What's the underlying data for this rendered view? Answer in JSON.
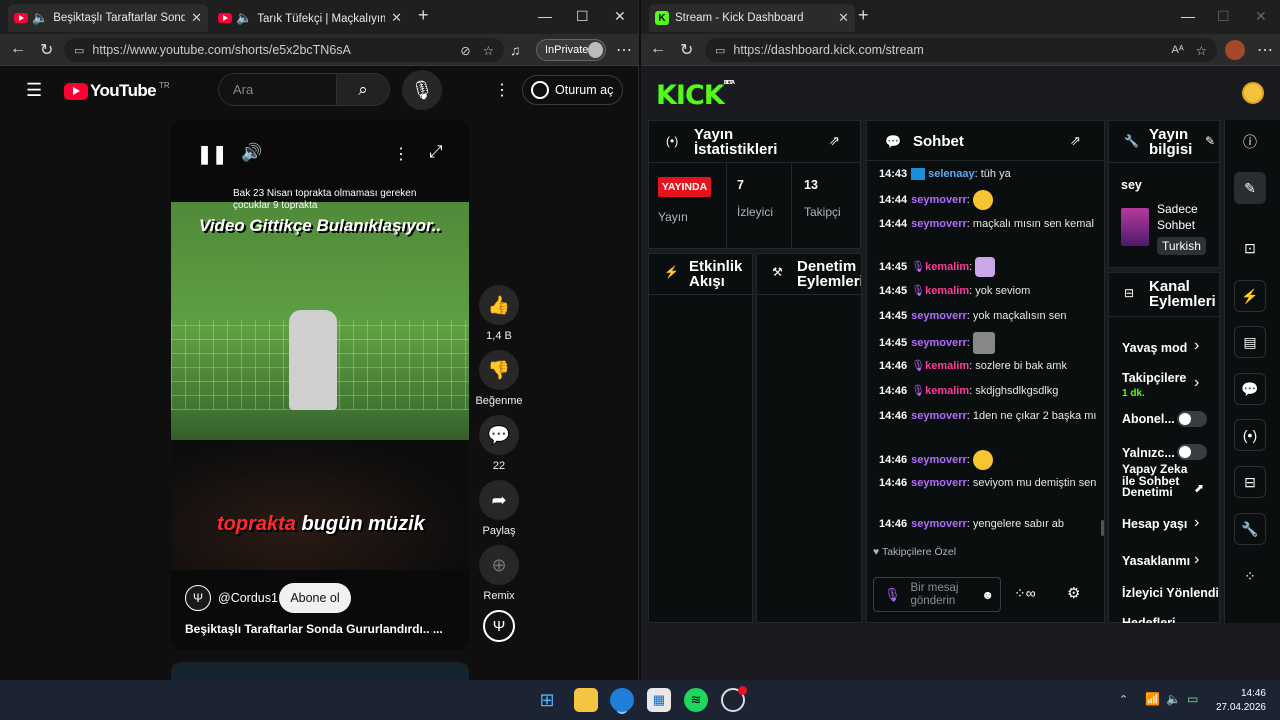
{
  "left_window": {
    "tabs": [
      {
        "title": "Beşiktaşlı Taraftarlar Sonda Gu"
      },
      {
        "title": "Tarık Tüfekçi | Maçkalıyım 🎧"
      }
    ],
    "url": "https://www.youtube.com/shorts/e5x2bcTN6sA",
    "inprivate_label": "InPrivate",
    "youtube": {
      "logo": "YouTube",
      "region": "TR",
      "search_placeholder": "Ara",
      "signin": "Oturum aç"
    },
    "short": {
      "top_caption": "Bak 23 Nisan toprakta olmaması gereken çocuklar 9 toprakta",
      "overlay_title": "Video Gittikçe Bulanıklaşıyor..",
      "overlay_bottom_a": "toprakta",
      "overlay_bottom_b": "bugün müzik",
      "channel": "@Cordus1",
      "subscribe": "Abone ol",
      "title": "Beşiktaşlı Taraftarlar Sonda Gururlandırdı.. ..."
    },
    "actions": {
      "likes": "1,4 B",
      "dislike": "Beğenme",
      "comments": "22",
      "share": "Paylaş",
      "remix": "Remix"
    }
  },
  "right_window": {
    "tab_title": "Stream - Kick Dashboard",
    "url": "https://dashboard.kick.com/stream",
    "logo": "KICK",
    "logo_badge": "BETA",
    "stats": {
      "heading": "Yayın İstatistikleri",
      "live_badge": "YAYINDA",
      "live_label": "Yayın",
      "viewers_value": "7",
      "viewers_label": "İzleyici",
      "followers_value": "13",
      "followers_label": "Takipçi"
    },
    "activity_heading": "Etkinlik Akışı",
    "moderation_heading": "Denetim Eylemleri",
    "chat": {
      "heading": "Sohbet",
      "messages": [
        {
          "time": "14:43",
          "user": "selenaay",
          "text": ": tüh ya"
        },
        {
          "time": "14:44",
          "user": "seymoverr",
          "text": ":"
        },
        {
          "time": "14:44",
          "user": "seymoverr",
          "text": ": maçkalı mısın sen kemal"
        },
        {
          "time": "14:45",
          "user": "kemalim",
          "text": ":"
        },
        {
          "time": "14:45",
          "user": "kemalim",
          "text": ": yok seviom"
        },
        {
          "time": "14:45",
          "user": "seymoverr",
          "text": ": yok maçkalısın sen"
        },
        {
          "time": "14:45",
          "user": "seymoverr",
          "text": ":"
        },
        {
          "time": "14:46",
          "user": "kemalim",
          "text": ": sozlere bi bak amk"
        },
        {
          "time": "14:46",
          "user": "kemalim",
          "text": ": skdjghsdlkgsdlkg"
        },
        {
          "time": "14:46",
          "user": "seymoverr",
          "text": ": 1den ne çıkar 2 başka mı"
        },
        {
          "time": "14:46",
          "user": "seymoverr",
          "text": ":"
        },
        {
          "time": "14:46",
          "user": "seymoverr",
          "text": ": seviyom mu demiştin sen"
        },
        {
          "time": "14:46",
          "user": "seymoverr",
          "text": ": yengelere sabır ab"
        }
      ],
      "followers_only": "Takipçilere Özel",
      "input_placeholder": "Bir mesaj gönderin"
    },
    "stream_info": {
      "heading": "Yayın bilgisi",
      "title": "sey",
      "category": "Sadece Sohbet",
      "language": "Turkish"
    },
    "channel_actions": {
      "heading": "Kanal Eylemleri",
      "slow_mode": "Yavaş mod",
      "followers_only": "Takipçilere",
      "followers_duration": "1 dk.",
      "subscribers": "Abonel...",
      "only": "Yalnızc...",
      "ai_moderation": "Yapay Zeka ile Sohbet Denetimi",
      "account_age": "Hesap yaşı",
      "bans": "Yasaklanmı",
      "viewer_redirect": "İzleyici Yönlendir",
      "goals": "Hedefleri"
    }
  },
  "taskbar": {
    "time": "14:46",
    "date": "27.04.2026"
  }
}
